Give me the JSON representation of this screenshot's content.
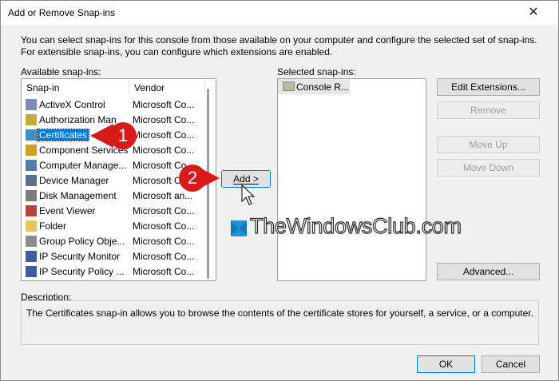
{
  "window": {
    "title": "Add or Remove Snap-ins",
    "close": "✕"
  },
  "intro": "You can select snap-ins for this console from those available on your computer and configure the selected set of snap-ins. For extensible snap-ins, you can configure which extensions are enabled.",
  "available": {
    "label": "Available snap-ins:",
    "columns": [
      "Snap-in",
      "Vendor"
    ],
    "items": [
      {
        "name": "ActiveX Control",
        "vendor": "Microsoft Co...",
        "icon": "activex-icon"
      },
      {
        "name": "Authorization Man",
        "vendor": "Microsoft Co...",
        "icon": "authorization-icon"
      },
      {
        "name": "Certificates",
        "vendor": "Microsoft Co...",
        "icon": "certificate-icon",
        "selected": true
      },
      {
        "name": "Component Services",
        "vendor": "Microsoft Co...",
        "icon": "component-icon"
      },
      {
        "name": "Computer Manage...",
        "vendor": "Microsoft Co...",
        "icon": "computer-icon"
      },
      {
        "name": "Device Manager",
        "vendor": "Microsoft Co...",
        "icon": "device-icon"
      },
      {
        "name": "Disk Management",
        "vendor": "Microsoft an...",
        "icon": "disk-icon"
      },
      {
        "name": "Event Viewer",
        "vendor": "Microsoft Co...",
        "icon": "event-icon"
      },
      {
        "name": "Folder",
        "vendor": "Microsoft Co...",
        "icon": "folder-icon"
      },
      {
        "name": "Group Policy Obje...",
        "vendor": "Microsoft Co...",
        "icon": "policy-icon"
      },
      {
        "name": "IP Security Monitor",
        "vendor": "Microsoft Co...",
        "icon": "security-icon"
      },
      {
        "name": "IP Security Policy ...",
        "vendor": "Microsoft Co...",
        "icon": "security-icon"
      }
    ]
  },
  "add_button": "Add >",
  "selected": {
    "label": "Selected snap-ins:",
    "items": [
      {
        "name": "Console R...",
        "icon": "folder-icon"
      }
    ]
  },
  "buttons": {
    "edit_extensions": "Edit Extensions...",
    "remove": "Remove",
    "move_up": "Move Up",
    "move_down": "Move Down",
    "advanced": "Advanced..."
  },
  "description": {
    "label": "Description:",
    "text": "The Certificates snap-in allows you to browse the contents of the certificate stores for yourself, a service, or a computer."
  },
  "footer": {
    "ok": "OK",
    "cancel": "Cancel"
  },
  "callouts": [
    "1",
    "2"
  ],
  "watermark": "TheWindowsClub.com",
  "colors": {
    "selection": "#0078d7",
    "callout": "#d81a1a"
  }
}
